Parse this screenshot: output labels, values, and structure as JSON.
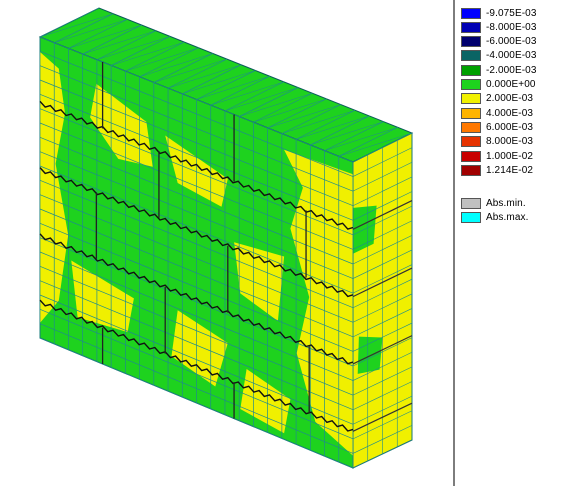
{
  "legend": {
    "entries": [
      {
        "label": "-9.075E-03",
        "color": "#0000ff"
      },
      {
        "label": "-8.000E-03",
        "color": "#0000b4"
      },
      {
        "label": "-6.000E-03",
        "color": "#00006e"
      },
      {
        "label": "-4.000E-03",
        "color": "#0a6464"
      },
      {
        "label": "-2.000E-03",
        "color": "#00a000"
      },
      {
        "label": "0.000E+00",
        "color": "#1ed21e"
      },
      {
        "label": "2.000E-03",
        "color": "#f0f000"
      },
      {
        "label": "4.000E-03",
        "color": "#ffb400"
      },
      {
        "label": "6.000E-03",
        "color": "#ff7800"
      },
      {
        "label": "8.000E-03",
        "color": "#e63200"
      },
      {
        "label": "1.000E-02",
        "color": "#c80000"
      },
      {
        "label": "1.214E-02",
        "color": "#a00000"
      }
    ],
    "extremes": [
      {
        "label": "Abs.min.",
        "color": "#c0c0c0"
      },
      {
        "label": "Abs.max.",
        "color": "#00ffff"
      }
    ]
  },
  "model": {
    "mesh_color": "#1e8c8c",
    "top_face_color": "#1ed21e",
    "front_base_color": "#1ed21e",
    "zone_color": "#f0f000",
    "side_face_color": "#f0f000",
    "edge_color": "#0a5a5a"
  }
}
